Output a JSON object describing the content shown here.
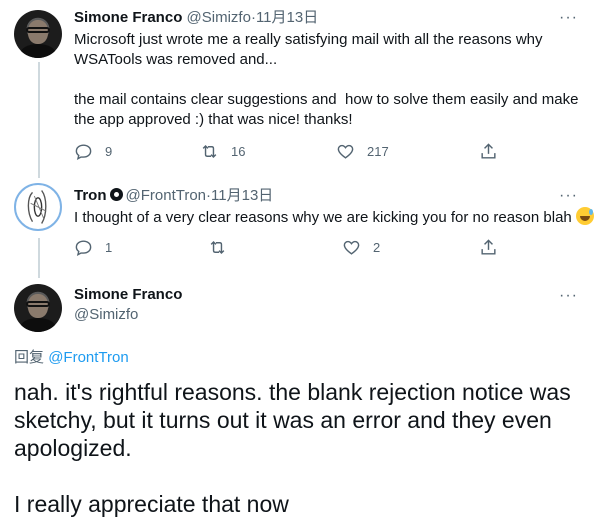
{
  "tweet1": {
    "name": "Simone Franco",
    "handle": "@Simizfo",
    "separator": "·",
    "date": "11月13日",
    "more": "···",
    "text": "Microsoft just wrote me a really satisfying mail with all the reasons why\nWSATools was removed and...\n\nthe mail contains clear suggestions and  how to solve them easily and make\nthe app approved :) that was nice! thanks!",
    "replies": "9",
    "retweets": "16",
    "likes": "217"
  },
  "tweet2": {
    "name": "Tron",
    "handle": "@FrontTron",
    "separator": "·",
    "date": "11月13日",
    "more": "···",
    "text": "I thought of a very clear reasons why we are kicking you for no reason blah",
    "emoji_icon": "sweat-smile-emoji",
    "replies": "1",
    "retweets": "",
    "likes": "2"
  },
  "tweet3": {
    "name": "Simone Franco",
    "handle": "@Simizfo",
    "more": "···",
    "reply_prefix": "回复",
    "reply_to": "@FrontTron",
    "text": "nah. it's rightful reasons. the blank rejection notice was\nsketchy, but it turns out it was an error and they even\napologized.\n\nI really appreciate that now"
  },
  "colors": {
    "text": "#0f1419",
    "secondary": "#536471",
    "link": "#1d9bf0",
    "thread_line": "#cfd9de"
  }
}
